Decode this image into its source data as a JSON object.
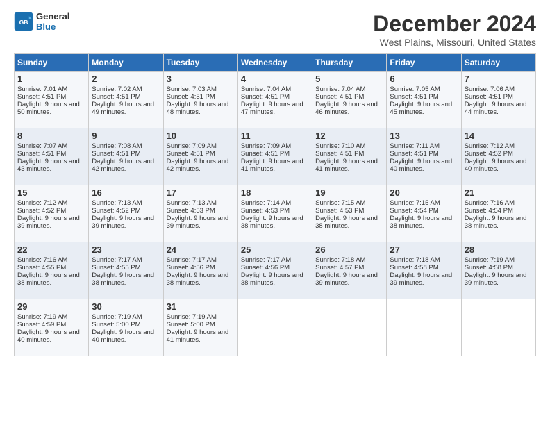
{
  "logo": {
    "line1": "General",
    "line2": "Blue"
  },
  "title": "December 2024",
  "subtitle": "West Plains, Missouri, United States",
  "days_header": [
    "Sunday",
    "Monday",
    "Tuesday",
    "Wednesday",
    "Thursday",
    "Friday",
    "Saturday"
  ],
  "weeks": [
    [
      {
        "day": "1",
        "sunrise": "7:01 AM",
        "sunset": "4:51 PM",
        "daylight": "9 hours and 50 minutes."
      },
      {
        "day": "2",
        "sunrise": "7:02 AM",
        "sunset": "4:51 PM",
        "daylight": "9 hours and 49 minutes."
      },
      {
        "day": "3",
        "sunrise": "7:03 AM",
        "sunset": "4:51 PM",
        "daylight": "9 hours and 48 minutes."
      },
      {
        "day": "4",
        "sunrise": "7:04 AM",
        "sunset": "4:51 PM",
        "daylight": "9 hours and 47 minutes."
      },
      {
        "day": "5",
        "sunrise": "7:04 AM",
        "sunset": "4:51 PM",
        "daylight": "9 hours and 46 minutes."
      },
      {
        "day": "6",
        "sunrise": "7:05 AM",
        "sunset": "4:51 PM",
        "daylight": "9 hours and 45 minutes."
      },
      {
        "day": "7",
        "sunrise": "7:06 AM",
        "sunset": "4:51 PM",
        "daylight": "9 hours and 44 minutes."
      }
    ],
    [
      {
        "day": "8",
        "sunrise": "7:07 AM",
        "sunset": "4:51 PM",
        "daylight": "9 hours and 43 minutes."
      },
      {
        "day": "9",
        "sunrise": "7:08 AM",
        "sunset": "4:51 PM",
        "daylight": "9 hours and 42 minutes."
      },
      {
        "day": "10",
        "sunrise": "7:09 AM",
        "sunset": "4:51 PM",
        "daylight": "9 hours and 42 minutes."
      },
      {
        "day": "11",
        "sunrise": "7:09 AM",
        "sunset": "4:51 PM",
        "daylight": "9 hours and 41 minutes."
      },
      {
        "day": "12",
        "sunrise": "7:10 AM",
        "sunset": "4:51 PM",
        "daylight": "9 hours and 41 minutes."
      },
      {
        "day": "13",
        "sunrise": "7:11 AM",
        "sunset": "4:51 PM",
        "daylight": "9 hours and 40 minutes."
      },
      {
        "day": "14",
        "sunrise": "7:12 AM",
        "sunset": "4:52 PM",
        "daylight": "9 hours and 40 minutes."
      }
    ],
    [
      {
        "day": "15",
        "sunrise": "7:12 AM",
        "sunset": "4:52 PM",
        "daylight": "9 hours and 39 minutes."
      },
      {
        "day": "16",
        "sunrise": "7:13 AM",
        "sunset": "4:52 PM",
        "daylight": "9 hours and 39 minutes."
      },
      {
        "day": "17",
        "sunrise": "7:13 AM",
        "sunset": "4:53 PM",
        "daylight": "9 hours and 39 minutes."
      },
      {
        "day": "18",
        "sunrise": "7:14 AM",
        "sunset": "4:53 PM",
        "daylight": "9 hours and 38 minutes."
      },
      {
        "day": "19",
        "sunrise": "7:15 AM",
        "sunset": "4:53 PM",
        "daylight": "9 hours and 38 minutes."
      },
      {
        "day": "20",
        "sunrise": "7:15 AM",
        "sunset": "4:54 PM",
        "daylight": "9 hours and 38 minutes."
      },
      {
        "day": "21",
        "sunrise": "7:16 AM",
        "sunset": "4:54 PM",
        "daylight": "9 hours and 38 minutes."
      }
    ],
    [
      {
        "day": "22",
        "sunrise": "7:16 AM",
        "sunset": "4:55 PM",
        "daylight": "9 hours and 38 minutes."
      },
      {
        "day": "23",
        "sunrise": "7:17 AM",
        "sunset": "4:55 PM",
        "daylight": "9 hours and 38 minutes."
      },
      {
        "day": "24",
        "sunrise": "7:17 AM",
        "sunset": "4:56 PM",
        "daylight": "9 hours and 38 minutes."
      },
      {
        "day": "25",
        "sunrise": "7:17 AM",
        "sunset": "4:56 PM",
        "daylight": "9 hours and 38 minutes."
      },
      {
        "day": "26",
        "sunrise": "7:18 AM",
        "sunset": "4:57 PM",
        "daylight": "9 hours and 39 minutes."
      },
      {
        "day": "27",
        "sunrise": "7:18 AM",
        "sunset": "4:58 PM",
        "daylight": "9 hours and 39 minutes."
      },
      {
        "day": "28",
        "sunrise": "7:19 AM",
        "sunset": "4:58 PM",
        "daylight": "9 hours and 39 minutes."
      }
    ],
    [
      {
        "day": "29",
        "sunrise": "7:19 AM",
        "sunset": "4:59 PM",
        "daylight": "9 hours and 40 minutes."
      },
      {
        "day": "30",
        "sunrise": "7:19 AM",
        "sunset": "5:00 PM",
        "daylight": "9 hours and 40 minutes."
      },
      {
        "day": "31",
        "sunrise": "7:19 AM",
        "sunset": "5:00 PM",
        "daylight": "9 hours and 41 minutes."
      },
      null,
      null,
      null,
      null
    ]
  ]
}
